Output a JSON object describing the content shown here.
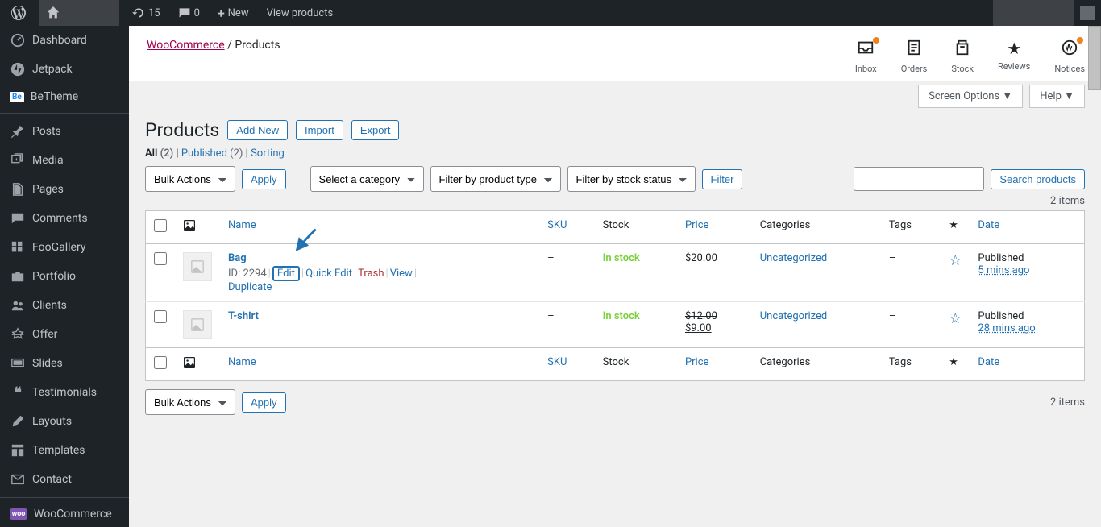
{
  "adminbar": {
    "refresh_count": "15",
    "comments_count": "0",
    "new_label": "New",
    "view_products": "View products"
  },
  "sidebar": {
    "items": [
      {
        "label": "Dashboard"
      },
      {
        "label": "Jetpack"
      },
      {
        "label": "BeTheme"
      },
      {
        "label": "Posts"
      },
      {
        "label": "Media"
      },
      {
        "label": "Pages"
      },
      {
        "label": "Comments"
      },
      {
        "label": "FooGallery"
      },
      {
        "label": "Portfolio"
      },
      {
        "label": "Clients"
      },
      {
        "label": "Offer"
      },
      {
        "label": "Slides"
      },
      {
        "label": "Testimonials"
      },
      {
        "label": "Layouts"
      },
      {
        "label": "Templates"
      },
      {
        "label": "Contact"
      },
      {
        "label": "WooCommerce"
      }
    ]
  },
  "breadcrumb": {
    "woocommerce": "WooCommerce",
    "sep": "/",
    "products": "Products"
  },
  "topicons": [
    {
      "label": "Inbox"
    },
    {
      "label": "Orders"
    },
    {
      "label": "Stock"
    },
    {
      "label": "Reviews"
    },
    {
      "label": "Notices"
    }
  ],
  "screen_opts": {
    "screen_options": "Screen Options",
    "help": "Help"
  },
  "page": {
    "title": "Products",
    "add_new": "Add New",
    "import": "Import",
    "export": "Export"
  },
  "subsub": {
    "all": "All",
    "all_count": "(2)",
    "published": "Published",
    "published_count": "(2)",
    "sorting": "Sorting"
  },
  "filters": {
    "bulk_actions": "Bulk Actions",
    "apply": "Apply",
    "select_category": "Select a category",
    "filter_type": "Filter by product type",
    "filter_stock": "Filter by stock status",
    "filter": "Filter",
    "search_products": "Search products",
    "items_count": "2 items"
  },
  "columns": {
    "name": "Name",
    "sku": "SKU",
    "stock": "Stock",
    "price": "Price",
    "categories": "Categories",
    "tags": "Tags",
    "date": "Date"
  },
  "rows": [
    {
      "name": "Bag",
      "id_prefix": "ID: 2294",
      "actions": {
        "edit": "Edit",
        "quick_edit": "Quick Edit",
        "trash": "Trash",
        "view": "View",
        "duplicate": "Duplicate"
      },
      "sku": "–",
      "stock": "In stock",
      "price": "$20.00",
      "categories": "Uncategorized",
      "tags": "–",
      "date_label": "Published",
      "date_value": "5 mins ago"
    },
    {
      "name": "T-shirt",
      "sku": "–",
      "stock": "In stock",
      "price_old": "$12.00",
      "price_new": "$9.00",
      "categories": "Uncategorized",
      "tags": "–",
      "date_label": "Published",
      "date_value": "28 mins ago"
    }
  ]
}
